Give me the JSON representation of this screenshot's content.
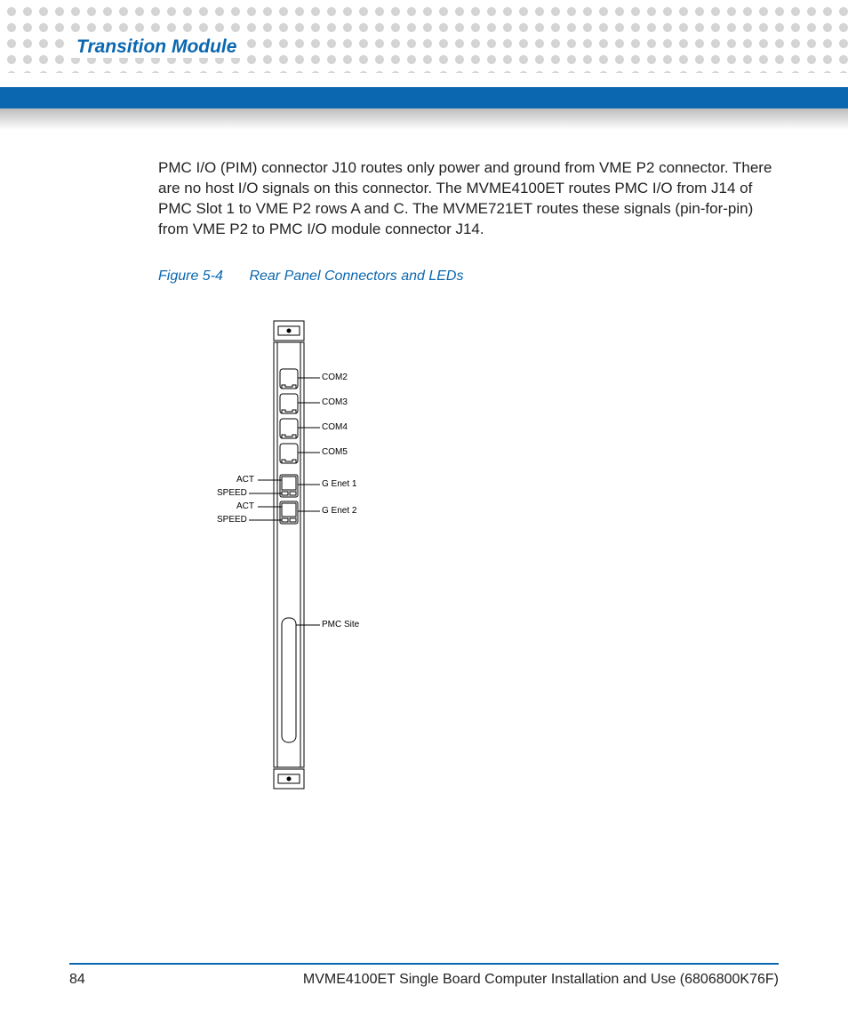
{
  "header": {
    "section_title": "Transition Module"
  },
  "body": {
    "paragraph": "PMC I/O (PIM) connector J10 routes only power and ground from VME P2 connector. There are no host I/O signals on this connector. The MVME4100ET routes PMC I/O from J14 of PMC Slot 1 to VME P2 rows A and C. The MVME721ET routes these signals (pin-for-pin) from VME P2 to PMC I/O module connector J14."
  },
  "figure": {
    "number": "Figure 5-4",
    "title": "Rear Panel Connectors and LEDs",
    "labels": {
      "com2": "COM2",
      "com3": "COM3",
      "com4": "COM4",
      "com5": "COM5",
      "genet1": "G Enet 1",
      "genet2": "G Enet 2",
      "pmcsite": "PMC Site",
      "act1": "ACT",
      "speed1": "SPEED",
      "act2": "ACT",
      "speed2": "SPEED"
    }
  },
  "footer": {
    "page": "84",
    "doc": "MVME4100ET Single Board Computer Installation and Use (6806800K76F)"
  }
}
